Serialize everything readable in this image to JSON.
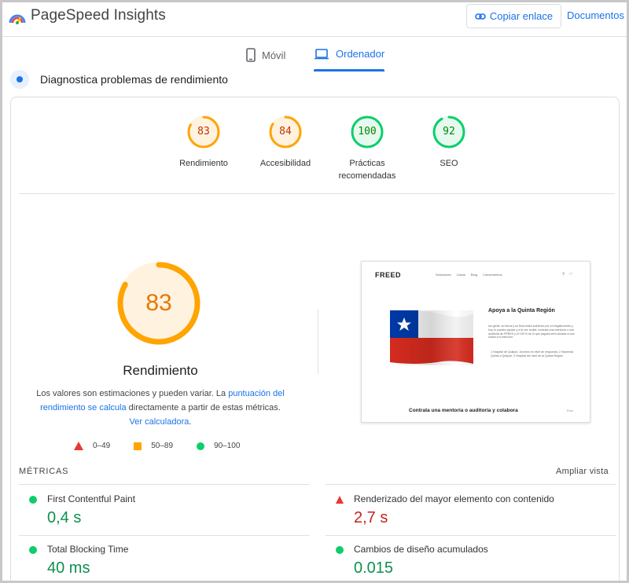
{
  "header": {
    "app_title": "PageSpeed Insights",
    "copy_link_label": "Copiar enlace",
    "docs_label": "Documentos"
  },
  "tabs": [
    {
      "label": "Móvil",
      "active": false
    },
    {
      "label": "Ordenador",
      "active": true
    }
  ],
  "section_title": "Diagnostica problemas de rendimiento",
  "scores": [
    {
      "label": "Rendimiento",
      "value": 83,
      "color": "#ffa400"
    },
    {
      "label": "Accesibilidad",
      "value": 84,
      "color": "#ffa400"
    },
    {
      "label": "Prácticas recomendadas",
      "value": 100,
      "color": "#0cce6b"
    },
    {
      "label": "SEO",
      "value": 92,
      "color": "#0cce6b"
    }
  ],
  "performance": {
    "score": 83,
    "label": "Rendimiento",
    "explain_prefix": "Los valores son estimaciones y pueden variar. La ",
    "explain_link1": "puntuación del rendimiento se calcula",
    "explain_middle": " directamente a partir de estas métricas. ",
    "explain_link2": "Ver calculadora",
    "explain_suffix": "."
  },
  "legend": {
    "poor": "0–49",
    "average": "50–89",
    "good": "90–100"
  },
  "thumbnail": {
    "logo": "FREED",
    "nav": [
      "Soluciones",
      "Casos",
      "Blog",
      "Conversemos"
    ],
    "heading": "Apoya a la Quinta Región",
    "body": "los gente, su fauna y su flora están sufriendo por el megaincendio y hoy tú puedes ayudar y a la vez recibir: contrata una mentoría o una auditoría de FREED y el 100 % de lo que pagues será donado a una causa a tu elección:",
    "list": "1 Hospital de Quilpué, Jovenes en nivel de respuesta; 2 Hacienda Quinta a Quilpué; 3 Hospital del nivel de la Quinta Región",
    "cta": "Contrata una mentoría o auditoría y colabora",
    "small": "Esto"
  },
  "metrics": {
    "heading": "MÉTRICAS",
    "expand_label": "Ampliar vista",
    "items": [
      {
        "name": "First Contentful Paint",
        "value": "0,4 s",
        "status": "good"
      },
      {
        "name": "Renderizado del mayor elemento con contenido",
        "value": "2,7 s",
        "status": "poor"
      },
      {
        "name": "Total Blocking Time",
        "value": "40 ms",
        "status": "good"
      },
      {
        "name": "Cambios de diseño acumulados",
        "value": "0.015",
        "status": "good"
      }
    ]
  }
}
